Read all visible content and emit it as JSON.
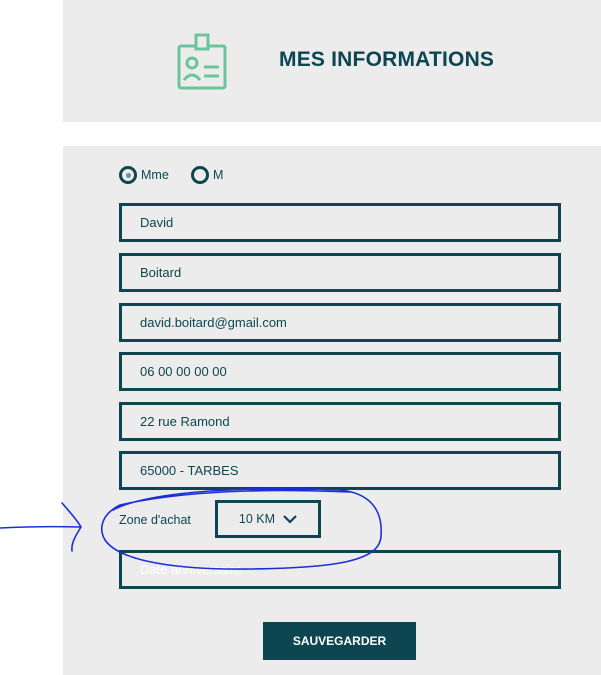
{
  "header": {
    "title": "MES INFORMATIONS",
    "icon": "id-badge-icon"
  },
  "form": {
    "civility": {
      "options": [
        "Mme",
        "M"
      ],
      "selected": "Mme"
    },
    "first_name": "David",
    "last_name": "Boitard",
    "email": "david.boitard@gmail.com",
    "phone": "06 00 00 00 00",
    "address": "22 rue Ramond",
    "city": "65000 - TARBES",
    "zone": {
      "label": "Zone d'achat",
      "value": "10 KM"
    },
    "birthday_placeholder": "Date anniversaire",
    "save_label": "SAUVEGARDER"
  },
  "colors": {
    "primary": "#0d4650",
    "icon": "#6cc49b",
    "card_bg": "#ececec",
    "annotation": "#1c2fd6"
  }
}
